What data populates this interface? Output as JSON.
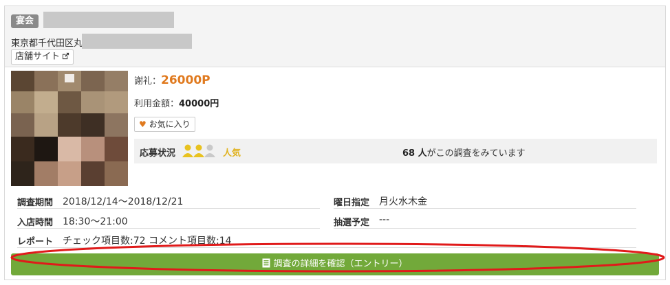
{
  "header": {
    "category_badge": "宴会",
    "address_prefix": "東京都千代田区丸",
    "shop_link_label": "店舗サイト"
  },
  "icons": {
    "external_link": "external-link-icon",
    "heart": "heart-icon",
    "person": "person-icon",
    "document": "document-icon"
  },
  "reward": {
    "label": "謝礼：",
    "value": "26000P"
  },
  "usage_amount": {
    "label": "利用金額：",
    "value": "40000円"
  },
  "favorite_label": "お気に入り",
  "status": {
    "label": "応募状況",
    "popularity": "人気",
    "popularity_level": 3,
    "viewers_count": "68 人",
    "viewers_suffix": "がこの調査をみています"
  },
  "details": {
    "period": {
      "label": "調査期間",
      "value": "2018/12/14〜2018/12/21"
    },
    "days": {
      "label": "曜日指定",
      "value": "月火水木金"
    },
    "time": {
      "label": "入店時間",
      "value": "18:30〜21:00"
    },
    "lottery": {
      "label": "抽選予定",
      "value": "---"
    },
    "report": {
      "label": "レポート",
      "value": "チェック項目数:72  コメント項目数:14"
    }
  },
  "cta_label": "調査の詳細を確認（エントリー）",
  "colors": {
    "accent": "#e07a1f",
    "cta": "#72a93a",
    "popular": "#e0b21f",
    "annotation": "#e01a1a"
  }
}
